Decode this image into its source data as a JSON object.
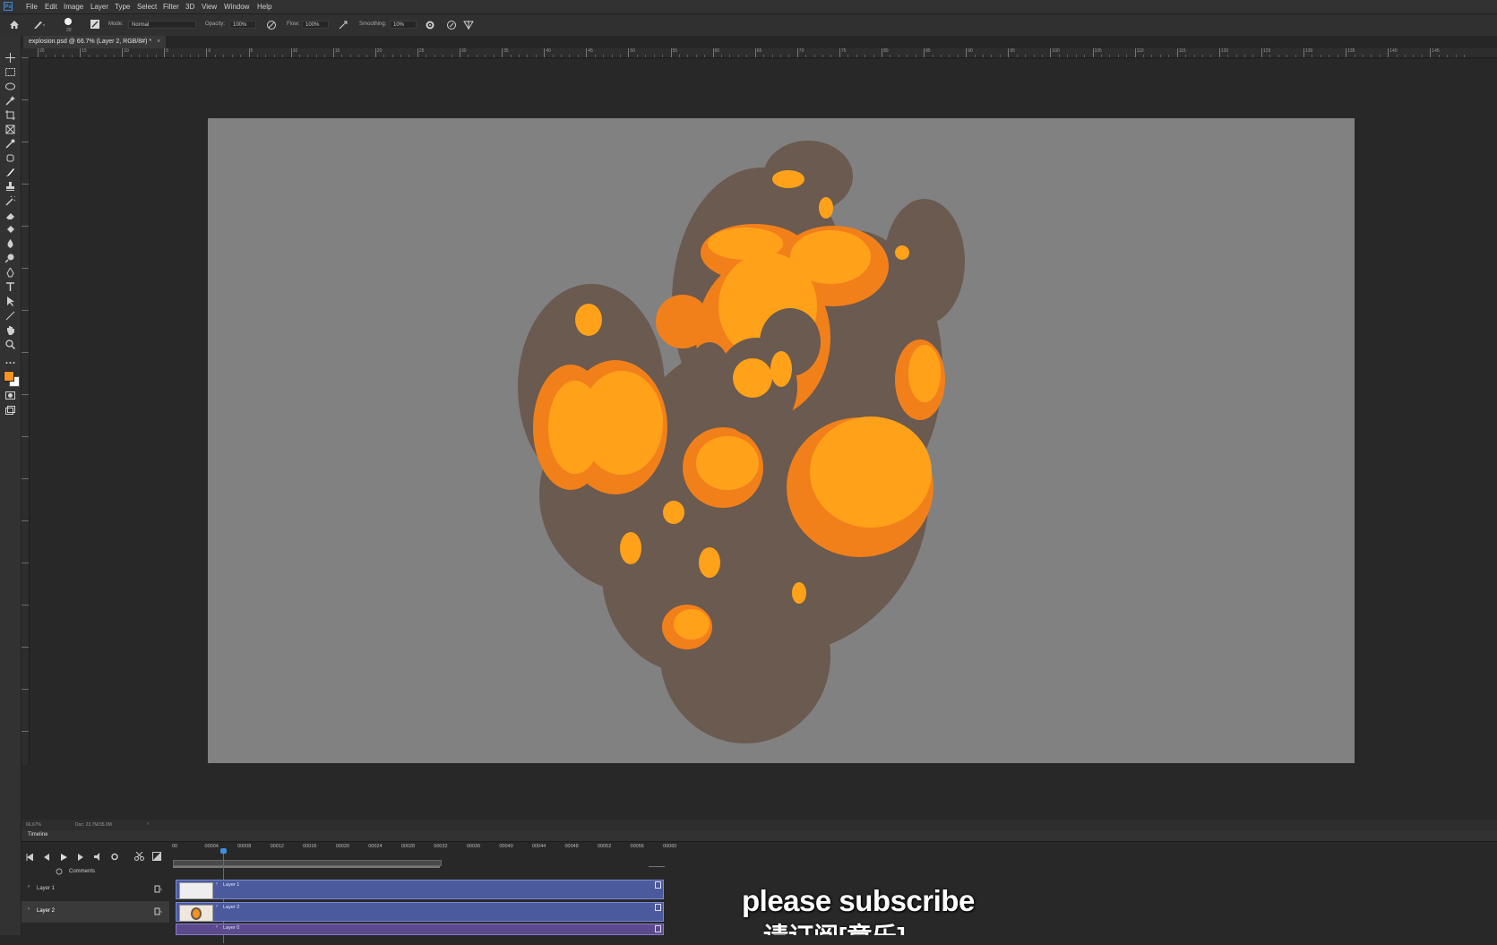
{
  "app": {
    "menu": [
      "File",
      "Edit",
      "Image",
      "Layer",
      "Type",
      "Select",
      "Filter",
      "3D",
      "View",
      "Window",
      "Help"
    ]
  },
  "options_bar": {
    "brush_size": "20",
    "mode_label": "Mode:",
    "mode_value": "Normal",
    "opacity_label": "Opacity:",
    "opacity_value": "100%",
    "flow_label": "Flow:",
    "flow_value": "100%",
    "smoothing_label": "Smoothing:",
    "smoothing_value": "10%"
  },
  "document": {
    "tab_title": "explosion.psd @ 66.7% (Layer 2, RGB/8#) *",
    "close_glyph": "×"
  },
  "ruler": {
    "top_labels": [
      "20",
      "15",
      "10",
      "5",
      "0",
      "5",
      "10",
      "15",
      "20",
      "25",
      "30",
      "35",
      "40",
      "45",
      "50",
      "55",
      "60",
      "65",
      "70",
      "75",
      "80",
      "85",
      "90",
      "95",
      "100",
      "105",
      "110",
      "115",
      "120",
      "125",
      "130",
      "135",
      "140",
      "145"
    ]
  },
  "status": {
    "zoom": "66.67%",
    "doc_size": "Doc: 23.7M/35.0M"
  },
  "timeline": {
    "title": "Timeline",
    "comments_label": "Comments",
    "frames": [
      "00",
      "00004",
      "00008",
      "00012",
      "00016",
      "00020",
      "00024",
      "00028",
      "00032",
      "00036",
      "00040",
      "00044",
      "00048",
      "00052",
      "00056",
      "00060"
    ],
    "playhead_fraction": 0.1,
    "layers": [
      {
        "name": "Layer 1",
        "clip_label": "Layer 1"
      },
      {
        "name": "Layer 2",
        "clip_label": "Layer 2"
      },
      {
        "name": "",
        "clip_label": "Layer 0"
      }
    ]
  },
  "overlay": {
    "subscribe_en": "please subscribe",
    "subscribe_cn": "请订阅[章乐]"
  },
  "colors": {
    "foreground": "#f7931e",
    "background": "#ffffff",
    "artboard": "#818181",
    "smoke": "#6a5a4f",
    "fire_light": "#ffa21a",
    "fire_dark": "#f2801a"
  }
}
